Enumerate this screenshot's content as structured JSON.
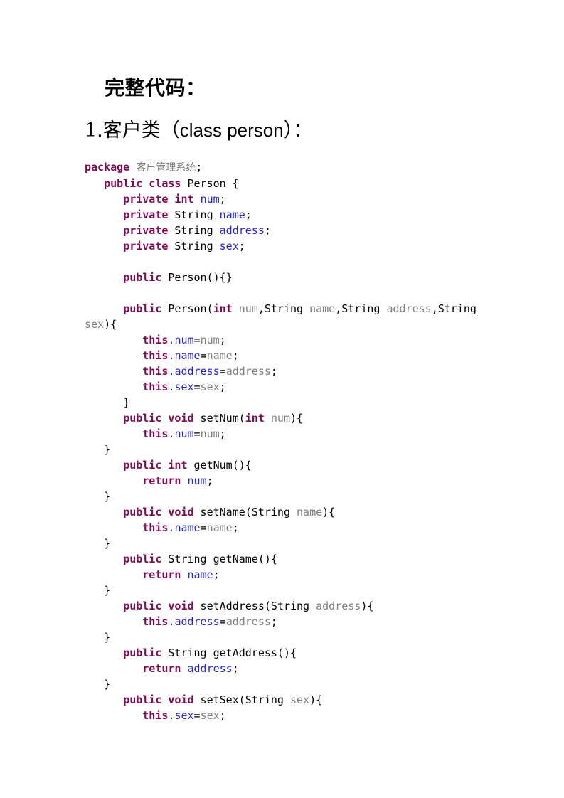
{
  "document": {
    "headings": {
      "title": "完整代码：",
      "section": {
        "number": "1.",
        "cn_before": "客户类（",
        "latin": "class person",
        "cn_after": "）："
      }
    },
    "code": {
      "language": "java",
      "colors": {
        "keyword": "#7F0B55",
        "identifier": "#2525CC",
        "variable": "#808080",
        "plain": "#000000",
        "background": "#FFFFFF"
      },
      "lines": [
        {
          "tokens": [
            {
              "t": "package",
              "c": "kw"
            },
            {
              "t": " ",
              "c": "pln"
            },
            {
              "t": "客户管理系统",
              "c": "pkg"
            },
            {
              "t": ";",
              "c": "pln"
            }
          ]
        },
        {
          "tokens": [
            {
              "t": "   ",
              "c": "pln"
            },
            {
              "t": "public class",
              "c": "kw"
            },
            {
              "t": " Person {",
              "c": "pln"
            }
          ]
        },
        {
          "tokens": [
            {
              "t": "      ",
              "c": "pln"
            },
            {
              "t": "private int",
              "c": "kw"
            },
            {
              "t": " ",
              "c": "pln"
            },
            {
              "t": "num",
              "c": "id"
            },
            {
              "t": ";",
              "c": "pln"
            }
          ]
        },
        {
          "tokens": [
            {
              "t": "      ",
              "c": "pln"
            },
            {
              "t": "private",
              "c": "kw"
            },
            {
              "t": " String ",
              "c": "pln"
            },
            {
              "t": "name",
              "c": "id"
            },
            {
              "t": ";",
              "c": "pln"
            }
          ]
        },
        {
          "tokens": [
            {
              "t": "      ",
              "c": "pln"
            },
            {
              "t": "private",
              "c": "kw"
            },
            {
              "t": " String ",
              "c": "pln"
            },
            {
              "t": "address",
              "c": "id"
            },
            {
              "t": ";",
              "c": "pln"
            }
          ]
        },
        {
          "tokens": [
            {
              "t": "      ",
              "c": "pln"
            },
            {
              "t": "private",
              "c": "kw"
            },
            {
              "t": " String ",
              "c": "pln"
            },
            {
              "t": "sex",
              "c": "id"
            },
            {
              "t": ";",
              "c": "pln"
            }
          ]
        },
        {
          "tokens": []
        },
        {
          "tokens": [
            {
              "t": "      ",
              "c": "pln"
            },
            {
              "t": "public",
              "c": "kw"
            },
            {
              "t": " Person(){}",
              "c": "pln"
            }
          ]
        },
        {
          "tokens": []
        },
        {
          "tokens": [
            {
              "t": "      ",
              "c": "pln"
            },
            {
              "t": "public",
              "c": "kw"
            },
            {
              "t": " Person(",
              "c": "pln"
            },
            {
              "t": "int",
              "c": "kw"
            },
            {
              "t": " ",
              "c": "pln"
            },
            {
              "t": "num",
              "c": "var"
            },
            {
              "t": ",String ",
              "c": "pln"
            },
            {
              "t": "name",
              "c": "var"
            },
            {
              "t": ",String ",
              "c": "pln"
            },
            {
              "t": "address",
              "c": "var"
            },
            {
              "t": ",String ",
              "c": "pln"
            },
            {
              "t": "sex",
              "c": "var"
            },
            {
              "t": "){",
              "c": "pln"
            }
          ]
        },
        {
          "tokens": [
            {
              "t": "         ",
              "c": "pln"
            },
            {
              "t": "this",
              "c": "kw"
            },
            {
              "t": ".",
              "c": "pln"
            },
            {
              "t": "num",
              "c": "id"
            },
            {
              "t": "=",
              "c": "pln"
            },
            {
              "t": "num",
              "c": "var"
            },
            {
              "t": ";",
              "c": "pln"
            }
          ]
        },
        {
          "tokens": [
            {
              "t": "         ",
              "c": "pln"
            },
            {
              "t": "this",
              "c": "kw"
            },
            {
              "t": ".",
              "c": "pln"
            },
            {
              "t": "name",
              "c": "id"
            },
            {
              "t": "=",
              "c": "pln"
            },
            {
              "t": "name",
              "c": "var"
            },
            {
              "t": ";",
              "c": "pln"
            }
          ]
        },
        {
          "tokens": [
            {
              "t": "         ",
              "c": "pln"
            },
            {
              "t": "this",
              "c": "kw"
            },
            {
              "t": ".",
              "c": "pln"
            },
            {
              "t": "address",
              "c": "id"
            },
            {
              "t": "=",
              "c": "pln"
            },
            {
              "t": "address",
              "c": "var"
            },
            {
              "t": ";",
              "c": "pln"
            }
          ]
        },
        {
          "tokens": [
            {
              "t": "         ",
              "c": "pln"
            },
            {
              "t": "this",
              "c": "kw"
            },
            {
              "t": ".",
              "c": "pln"
            },
            {
              "t": "sex",
              "c": "id"
            },
            {
              "t": "=",
              "c": "pln"
            },
            {
              "t": "sex",
              "c": "var"
            },
            {
              "t": ";",
              "c": "pln"
            }
          ]
        },
        {
          "tokens": [
            {
              "t": "      }",
              "c": "pln"
            }
          ]
        },
        {
          "tokens": [
            {
              "t": "      ",
              "c": "pln"
            },
            {
              "t": "public void",
              "c": "kw"
            },
            {
              "t": " setNum(",
              "c": "pln"
            },
            {
              "t": "int",
              "c": "kw"
            },
            {
              "t": " ",
              "c": "pln"
            },
            {
              "t": "num",
              "c": "var"
            },
            {
              "t": "){",
              "c": "pln"
            }
          ]
        },
        {
          "tokens": [
            {
              "t": "         ",
              "c": "pln"
            },
            {
              "t": "this",
              "c": "kw"
            },
            {
              "t": ".",
              "c": "pln"
            },
            {
              "t": "num",
              "c": "id"
            },
            {
              "t": "=",
              "c": "pln"
            },
            {
              "t": "num",
              "c": "var"
            },
            {
              "t": ";",
              "c": "pln"
            }
          ]
        },
        {
          "tokens": [
            {
              "t": "   }",
              "c": "pln"
            }
          ]
        },
        {
          "tokens": [
            {
              "t": "      ",
              "c": "pln"
            },
            {
              "t": "public int",
              "c": "kw"
            },
            {
              "t": " getNum(){",
              "c": "pln"
            }
          ]
        },
        {
          "tokens": [
            {
              "t": "         ",
              "c": "pln"
            },
            {
              "t": "return",
              "c": "kw"
            },
            {
              "t": " ",
              "c": "pln"
            },
            {
              "t": "num",
              "c": "id"
            },
            {
              "t": ";",
              "c": "pln"
            }
          ]
        },
        {
          "tokens": [
            {
              "t": "   }",
              "c": "pln"
            }
          ]
        },
        {
          "tokens": [
            {
              "t": "      ",
              "c": "pln"
            },
            {
              "t": "public void",
              "c": "kw"
            },
            {
              "t": " setName(String ",
              "c": "pln"
            },
            {
              "t": "name",
              "c": "var"
            },
            {
              "t": "){",
              "c": "pln"
            }
          ]
        },
        {
          "tokens": [
            {
              "t": "         ",
              "c": "pln"
            },
            {
              "t": "this",
              "c": "kw"
            },
            {
              "t": ".",
              "c": "pln"
            },
            {
              "t": "name",
              "c": "id"
            },
            {
              "t": "=",
              "c": "pln"
            },
            {
              "t": "name",
              "c": "var"
            },
            {
              "t": ";",
              "c": "pln"
            }
          ]
        },
        {
          "tokens": [
            {
              "t": "   }",
              "c": "pln"
            }
          ]
        },
        {
          "tokens": [
            {
              "t": "      ",
              "c": "pln"
            },
            {
              "t": "public",
              "c": "kw"
            },
            {
              "t": " String getName(){",
              "c": "pln"
            }
          ]
        },
        {
          "tokens": [
            {
              "t": "         ",
              "c": "pln"
            },
            {
              "t": "return",
              "c": "kw"
            },
            {
              "t": " ",
              "c": "pln"
            },
            {
              "t": "name",
              "c": "id"
            },
            {
              "t": ";",
              "c": "pln"
            }
          ]
        },
        {
          "tokens": [
            {
              "t": "   }",
              "c": "pln"
            }
          ]
        },
        {
          "tokens": [
            {
              "t": "      ",
              "c": "pln"
            },
            {
              "t": "public void",
              "c": "kw"
            },
            {
              "t": " setAddress(String ",
              "c": "pln"
            },
            {
              "t": "address",
              "c": "var"
            },
            {
              "t": "){",
              "c": "pln"
            }
          ]
        },
        {
          "tokens": [
            {
              "t": "         ",
              "c": "pln"
            },
            {
              "t": "this",
              "c": "kw"
            },
            {
              "t": ".",
              "c": "pln"
            },
            {
              "t": "address",
              "c": "id"
            },
            {
              "t": "=",
              "c": "pln"
            },
            {
              "t": "address",
              "c": "var"
            },
            {
              "t": ";",
              "c": "pln"
            }
          ]
        },
        {
          "tokens": [
            {
              "t": "   }",
              "c": "pln"
            }
          ]
        },
        {
          "tokens": [
            {
              "t": "      ",
              "c": "pln"
            },
            {
              "t": "public",
              "c": "kw"
            },
            {
              "t": " String getAddress(){",
              "c": "pln"
            }
          ]
        },
        {
          "tokens": [
            {
              "t": "         ",
              "c": "pln"
            },
            {
              "t": "return",
              "c": "kw"
            },
            {
              "t": " ",
              "c": "pln"
            },
            {
              "t": "address",
              "c": "id"
            },
            {
              "t": ";",
              "c": "pln"
            }
          ]
        },
        {
          "tokens": [
            {
              "t": "   }",
              "c": "pln"
            }
          ]
        },
        {
          "tokens": [
            {
              "t": "      ",
              "c": "pln"
            },
            {
              "t": "public void",
              "c": "kw"
            },
            {
              "t": " setSex(String ",
              "c": "pln"
            },
            {
              "t": "sex",
              "c": "var"
            },
            {
              "t": "){",
              "c": "pln"
            }
          ]
        },
        {
          "tokens": [
            {
              "t": "         ",
              "c": "pln"
            },
            {
              "t": "this",
              "c": "kw"
            },
            {
              "t": ".",
              "c": "pln"
            },
            {
              "t": "sex",
              "c": "id"
            },
            {
              "t": "=",
              "c": "pln"
            },
            {
              "t": "sex",
              "c": "var"
            },
            {
              "t": ";",
              "c": "pln"
            }
          ]
        }
      ]
    }
  }
}
